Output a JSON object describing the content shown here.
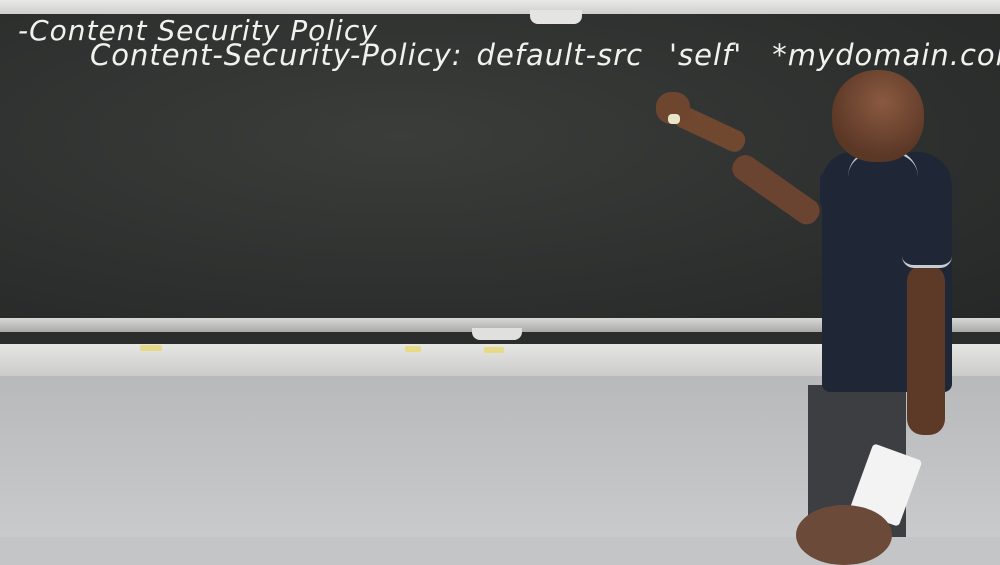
{
  "scene": "lecture",
  "board": {
    "line1": "-Content Security Policy",
    "line2": {
      "header": "Content-Security-Policy:",
      "directive": "default-src",
      "self": "'self'",
      "domain": "*mydomain.com"
    }
  },
  "colors": {
    "board": "#2e302e",
    "chalk": "#f1f1ee",
    "shirt": "#1f2736",
    "wall": "#c4c5c7"
  }
}
